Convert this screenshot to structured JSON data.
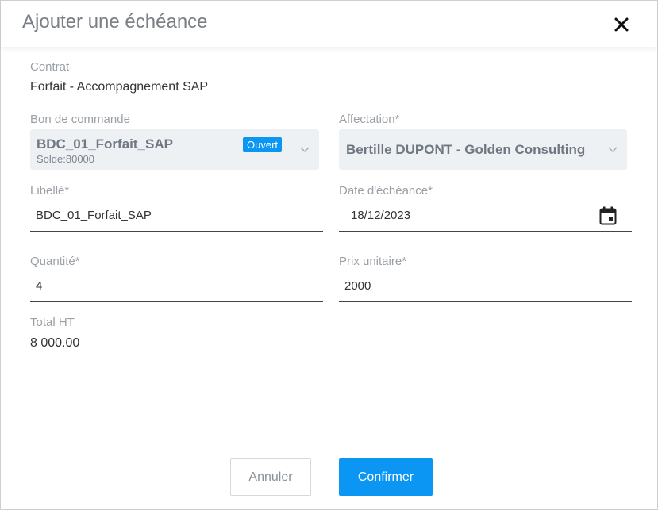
{
  "dialog": {
    "title": "Ajouter une échéance"
  },
  "contract": {
    "label": "Contrat",
    "value": "Forfait - Accompagnement SAP"
  },
  "purchase_order": {
    "label": "Bon de commande",
    "value": "BDC_01_Forfait_SAP",
    "balance": "Solde:80000",
    "status": "Ouvert",
    "status_color": "#0a96f2"
  },
  "assignment": {
    "label": "Affectation*",
    "value": "Bertille DUPONT - Golden Consulting"
  },
  "wording": {
    "label": "Libellé*",
    "value": "BDC_01_Forfait_SAP"
  },
  "due_date": {
    "label": "Date d'échéance*",
    "value": "18/12/2023"
  },
  "quantity": {
    "label": "Quantité*",
    "value": "4"
  },
  "unit_price": {
    "label": "Prix unitaire*",
    "value": "2000"
  },
  "total": {
    "label": "Total HT",
    "value": "8 000.00"
  },
  "actions": {
    "cancel_label": "Annuler",
    "confirm_label": "Confirmer",
    "accent_color": "#0a96f2"
  },
  "icons": {
    "close": "close-icon",
    "chevron": "chevron-down-icon",
    "calendar": "calendar-icon"
  }
}
